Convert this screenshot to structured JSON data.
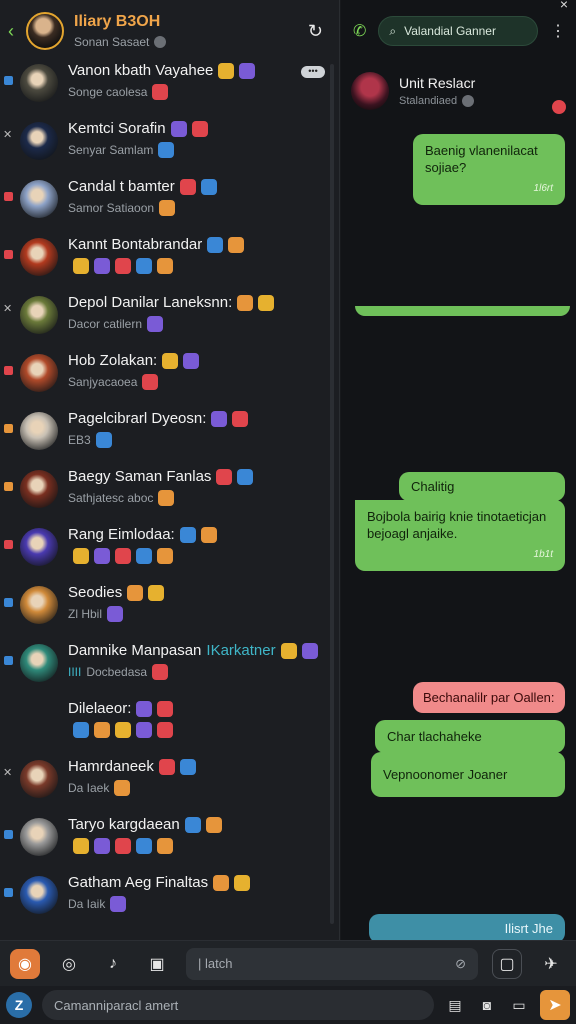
{
  "header": {
    "title": "Iliary B3OH",
    "subtitle": "Sonan Sasaet"
  },
  "chats": [
    {
      "name": "Vanon kbath Vayahee",
      "sub": "Songe caolesa",
      "marker": "#3a87d6",
      "avatar": "#4c4a3f",
      "more": "•••"
    },
    {
      "name": "Kemtci Sorafin",
      "sub": "Senyar Samlam",
      "marker": "x",
      "avatar": "#1c2a4a"
    },
    {
      "name": "Candal t bamter",
      "sub": "Samor Satiaoon",
      "marker": "#e0454c",
      "avatar": "#8ea3c8"
    },
    {
      "name": "Kannt Bontabrandar",
      "sub": "",
      "marker": "#e0454c",
      "avatar": "#b23a1f"
    },
    {
      "name": "Depol Danilar Laneksnn:",
      "sub": "Dacor catilern",
      "marker": "x",
      "avatar": "#6b7a3a"
    },
    {
      "name": "Hob Zolakan:",
      "sub": "Sanjyacaoea",
      "marker": "#e0454c",
      "avatar": "#b04a2a"
    },
    {
      "name": "Pagelcibrarl Dyeosn:",
      "sub": "EB3",
      "marker": "#e6953b",
      "avatar": "#c8c0b4"
    },
    {
      "name": "Baegy Saman Fanlas",
      "sub": "Sathjatesc aboc",
      "marker": "#e6953b",
      "avatar": "#7a2f20"
    },
    {
      "name": "Rang Eimlodaa:",
      "sub": "",
      "marker": "#e0454c",
      "avatar": "#4a3ab0"
    },
    {
      "name": "Seodies",
      "sub": "Zl Hbil",
      "marker": "#3a87d6",
      "avatar": "#d08a3a"
    },
    {
      "name": "Damnike Manpasan",
      "name_hl": "IKarkatner",
      "name2": "IIII",
      "sub": "Docbedasa",
      "marker": "#3a87d6",
      "avatar": "#2f8a7a"
    },
    {
      "name": "Dilelaeor:",
      "sub": "",
      "marker": "",
      "avatar": ""
    },
    {
      "name": "Hamrdaneek",
      "sub": "Da Iaek",
      "marker": "x",
      "avatar": "#7a3a2a"
    },
    {
      "name": "Taryo kargdaean",
      "sub": "",
      "marker": "#3a87d6",
      "avatar": "#9a9a9a"
    },
    {
      "name": "Gatham Aeg Finaltas",
      "sub": "Da Iaik",
      "marker": "#3a87d6",
      "avatar": "#2a5ab0"
    }
  ],
  "conversation": {
    "search_placeholder": "Valandial Ganner",
    "contact_name": "Unit Reslacr",
    "contact_sub": "Stalandiaed",
    "messages": [
      {
        "text": "Baenig vlanenilacat sojiae?",
        "meta": "1l6rt",
        "type": "out"
      },
      {
        "text": "Chalitig",
        "meta": "",
        "type": "out"
      },
      {
        "text": "Bojbola bairig knie tinotaeticjan bejoagl anjaike.",
        "meta": "1b1t",
        "type": "out"
      },
      {
        "text": "Bechanalilr par Oallen:",
        "meta": "",
        "type": "pink"
      },
      {
        "text": "Char tlachaheke",
        "meta": "",
        "type": "out"
      },
      {
        "text": "Vepnoonomer Joaner",
        "meta": "",
        "type": "out"
      },
      {
        "text": "Ilisrt Jhe",
        "meta": "",
        "type": "teal"
      }
    ]
  },
  "toolbar": {
    "search_placeholder": "| latch"
  },
  "composer": {
    "placeholder": "Camanniparacl amert"
  },
  "icons": [
    "back-icon",
    "refresh-icon",
    "call-icon",
    "search-icon",
    "kebab-icon",
    "close-icon",
    "camera-icon",
    "record-icon",
    "music-icon",
    "image-icon",
    "link-icon",
    "screen-icon",
    "pin-icon",
    "logo-icon",
    "document-icon",
    "camera-small-icon",
    "chat-icon",
    "send-icon"
  ],
  "colors": {
    "accent_green": "#6fc05a",
    "title_orange": "#f0a54a",
    "pink": "#f08a8a",
    "teal": "#3e8fa6"
  }
}
